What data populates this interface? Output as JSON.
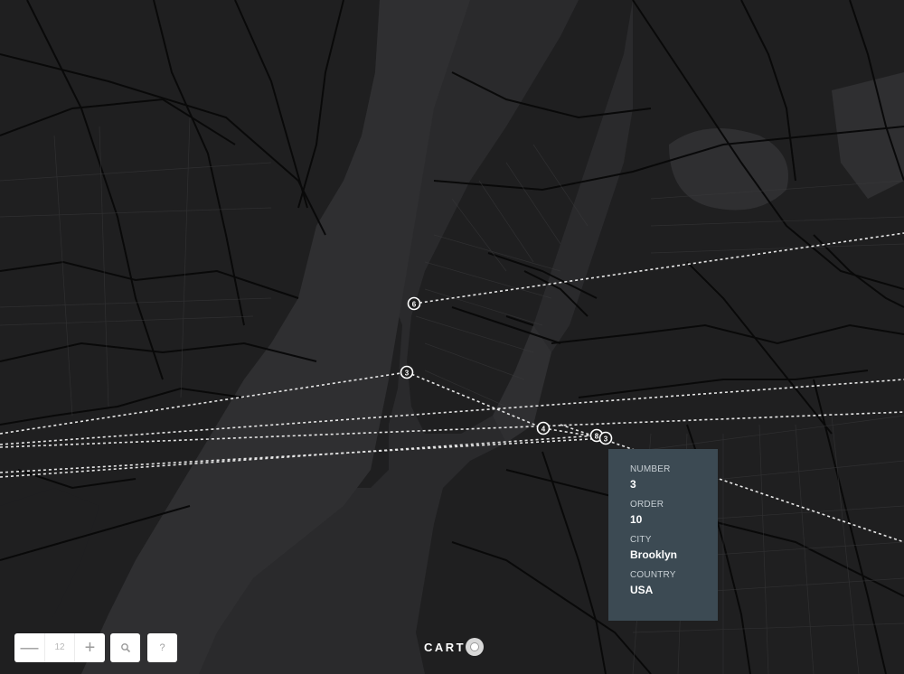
{
  "map": {
    "zoom_level": "12",
    "markers": [
      {
        "label": "6"
      },
      {
        "label": "3"
      },
      {
        "label": "4"
      },
      {
        "label": "8"
      },
      {
        "label": "3"
      }
    ]
  },
  "popup": {
    "fields": [
      {
        "label": "NUMBER",
        "value": "3"
      },
      {
        "label": "ORDER",
        "value": "10"
      },
      {
        "label": "CITY",
        "value": "Brooklyn"
      },
      {
        "label": "COUNTRY",
        "value": "USA"
      }
    ]
  },
  "controls": {
    "zoom_out_symbol": "—",
    "zoom_in_symbol": "+",
    "search_icon": "search-icon",
    "help_label": "?"
  },
  "logo": {
    "text": "CART"
  },
  "colors": {
    "water": "#2b2b2d",
    "land": "#1e1e1f",
    "road": "#000000",
    "popup_bg": "#3c4a53",
    "route_line": "#e6e6e6"
  }
}
